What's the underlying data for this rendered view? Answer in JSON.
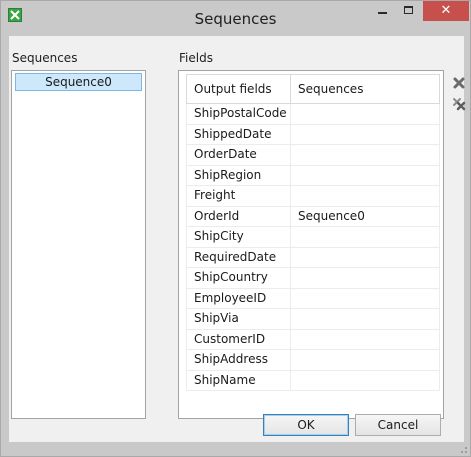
{
  "window": {
    "title": "Sequences",
    "close_glyph": "✕"
  },
  "sequences_panel": {
    "label": "Sequences",
    "items": [
      {
        "label": "Sequence0",
        "selected": true
      }
    ]
  },
  "fields_panel": {
    "label": "Fields",
    "columns": [
      "Output fields",
      "Sequences"
    ],
    "rows": [
      {
        "field": "ShipPostalCode",
        "sequence": ""
      },
      {
        "field": "ShippedDate",
        "sequence": ""
      },
      {
        "field": "OrderDate",
        "sequence": ""
      },
      {
        "field": "ShipRegion",
        "sequence": ""
      },
      {
        "field": "Freight",
        "sequence": ""
      },
      {
        "field": "OrderId",
        "sequence": "Sequence0"
      },
      {
        "field": "ShipCity",
        "sequence": ""
      },
      {
        "field": "RequiredDate",
        "sequence": ""
      },
      {
        "field": "ShipCountry",
        "sequence": ""
      },
      {
        "field": "EmployeeID",
        "sequence": ""
      },
      {
        "field": "ShipVia",
        "sequence": ""
      },
      {
        "field": "CustomerID",
        "sequence": ""
      },
      {
        "field": "ShipAddress",
        "sequence": ""
      },
      {
        "field": "ShipName",
        "sequence": ""
      }
    ],
    "actions": [
      {
        "icon": "delete-icon"
      },
      {
        "icon": "delete-all-icon"
      }
    ]
  },
  "footer": {
    "ok_label": "OK",
    "cancel_label": "Cancel"
  },
  "colors": {
    "titlebar": "#c9c9c9",
    "close_button": "#c7504c",
    "selection": "#cde8fb",
    "app_icon": "#3aa447"
  }
}
